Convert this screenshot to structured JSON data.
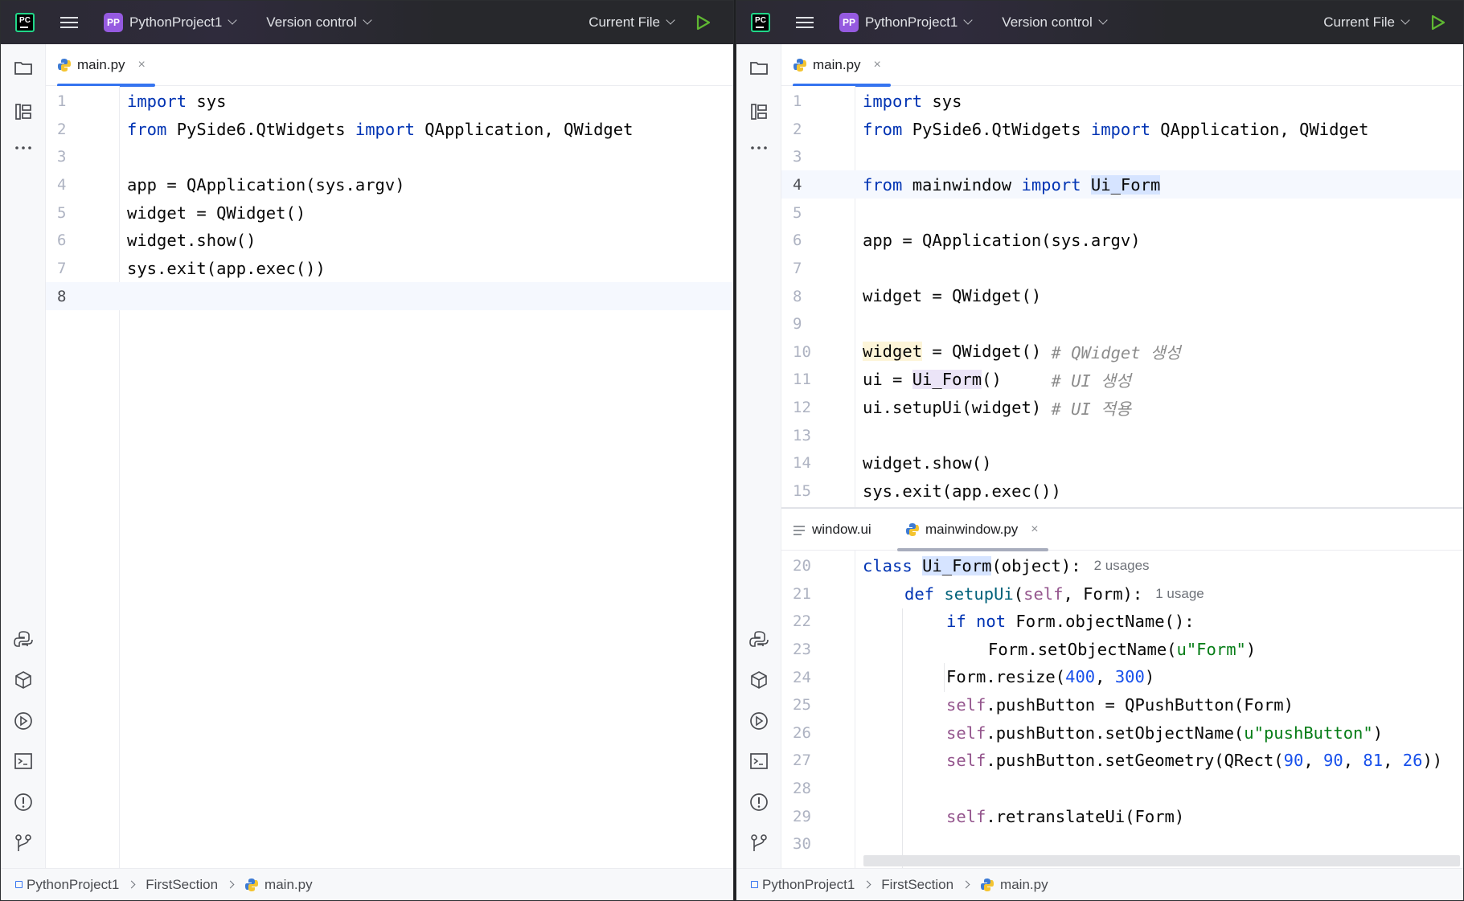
{
  "windows": {
    "left": {
      "app_logo": "PC",
      "project_badge": "PP",
      "project_name": "PythonProject1",
      "version_control": "Version control",
      "run_config": "Current File",
      "tab": {
        "name": "main.py",
        "close": "×"
      },
      "status": [
        "PythonProject1",
        "FirstSection",
        "main.py"
      ]
    },
    "right": {
      "app_logo": "PC",
      "project_badge": "PP",
      "project_name": "PythonProject1",
      "version_control": "Version control",
      "run_config": "Current File",
      "tab": {
        "name": "main.py",
        "close": "×"
      },
      "lower_tabs": [
        {
          "name": "window.ui"
        },
        {
          "name": "mainwindow.py",
          "close": "×"
        }
      ],
      "status": [
        "PythonProject1",
        "FirstSection",
        "main.py"
      ]
    }
  },
  "left_lines": [
    "1",
    "2",
    "3",
    "4",
    "5",
    "6",
    "7",
    "8"
  ],
  "right_lines": [
    "1",
    "2",
    "3",
    "4",
    "5",
    "6",
    "7",
    "8",
    "9",
    "10",
    "11",
    "12",
    "13",
    "14",
    "15"
  ],
  "lower_lines": [
    "20",
    "21",
    "22",
    "23",
    "24",
    "25",
    "26",
    "27",
    "28",
    "29",
    "30"
  ],
  "left_code": {
    "l1": [
      "import",
      " sys"
    ],
    "l2": [
      "from",
      " PySide6.QtWidgets ",
      "import",
      " QApplication, QWidget"
    ],
    "l4": "app = QApplication(sys.argv)",
    "l5": "widget = QWidget()",
    "l6": "widget.show()",
    "l7": "sys.exit(app.exec())"
  },
  "right_code": {
    "l1": [
      "import",
      " sys"
    ],
    "l2": [
      "from",
      " PySide6.QtWidgets ",
      "import",
      " QApplication, QWidget"
    ],
    "l4": [
      "from",
      " mainwindow ",
      "import",
      " ",
      "Ui_Form"
    ],
    "l6": "app = QApplication(sys.argv)",
    "l8": "widget = QWidget()",
    "l10": [
      "widget",
      " = QWidget() ",
      "# QWidget 생성"
    ],
    "l11": [
      "ui = ",
      "Ui_Form",
      "()     ",
      "# UI 생성"
    ],
    "l12": [
      "ui.setupUi(widget) ",
      "# UI 적용"
    ],
    "l14": "widget.show()",
    "l15": "sys.exit(app.exec())"
  },
  "lower_code": {
    "l20": [
      "class",
      " ",
      "Ui_Form",
      "(object):",
      "2 usages"
    ],
    "l21": [
      "def",
      " ",
      "setupUi",
      "(",
      "self",
      ", Form):",
      "1 usage"
    ],
    "l22": [
      "if",
      " ",
      "not",
      " Form.objectName():"
    ],
    "l23": [
      "Form.setObjectName(",
      "u\"Form\"",
      ")"
    ],
    "l24": [
      "Form.resize(",
      "400",
      ", ",
      "300",
      ")"
    ],
    "l25": [
      "self",
      ".pushButton = QPushButton(Form)"
    ],
    "l26": [
      "self",
      ".pushButton.setObjectName(",
      "u\"pushButton\"",
      ")"
    ],
    "l27": [
      "self",
      ".pushButton.setGeometry(QRect(",
      "90",
      ", ",
      "90",
      ", ",
      "81",
      ", ",
      "26",
      "))"
    ],
    "l29": [
      "self",
      ".retranslateUi(Form)"
    ]
  },
  "colors": {
    "keyword": "#0033b3",
    "comment": "#8c8c8c",
    "string": "#067d17",
    "number": "#1750eb",
    "self": "#94558d",
    "accent": "#3574f0",
    "run": "#5fb832"
  },
  "icons": [
    "folder-icon",
    "structure-icon",
    "more-icon",
    "python-console-icon",
    "python-packages-icon",
    "services-icon",
    "terminal-icon",
    "problems-icon",
    "git-icon",
    "run-icon",
    "python-file-icon"
  ]
}
